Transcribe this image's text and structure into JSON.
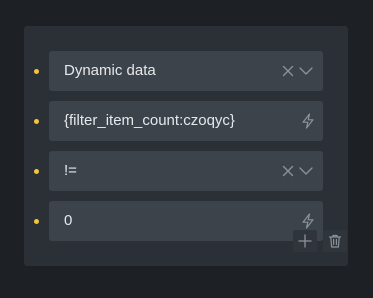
{
  "conditions": [
    {
      "value": "Dynamic data",
      "type": "select"
    },
    {
      "value": "{filter_item_count:czoqyc}",
      "type": "dynamic-input"
    },
    {
      "value": "!=",
      "type": "select"
    },
    {
      "value": "0",
      "type": "dynamic-input"
    }
  ],
  "colors": {
    "background": "#1d2024",
    "panel": "#2b3036",
    "field": "#3c434b",
    "text": "#e6e8ea",
    "icon": "#8b949c",
    "dot": "#f2c53d"
  },
  "icons": {
    "clear": "close-icon",
    "dropdown": "chevron-down-icon",
    "dynamic": "lightning-bolt-icon",
    "add": "plus-icon",
    "delete": "trash-icon"
  }
}
